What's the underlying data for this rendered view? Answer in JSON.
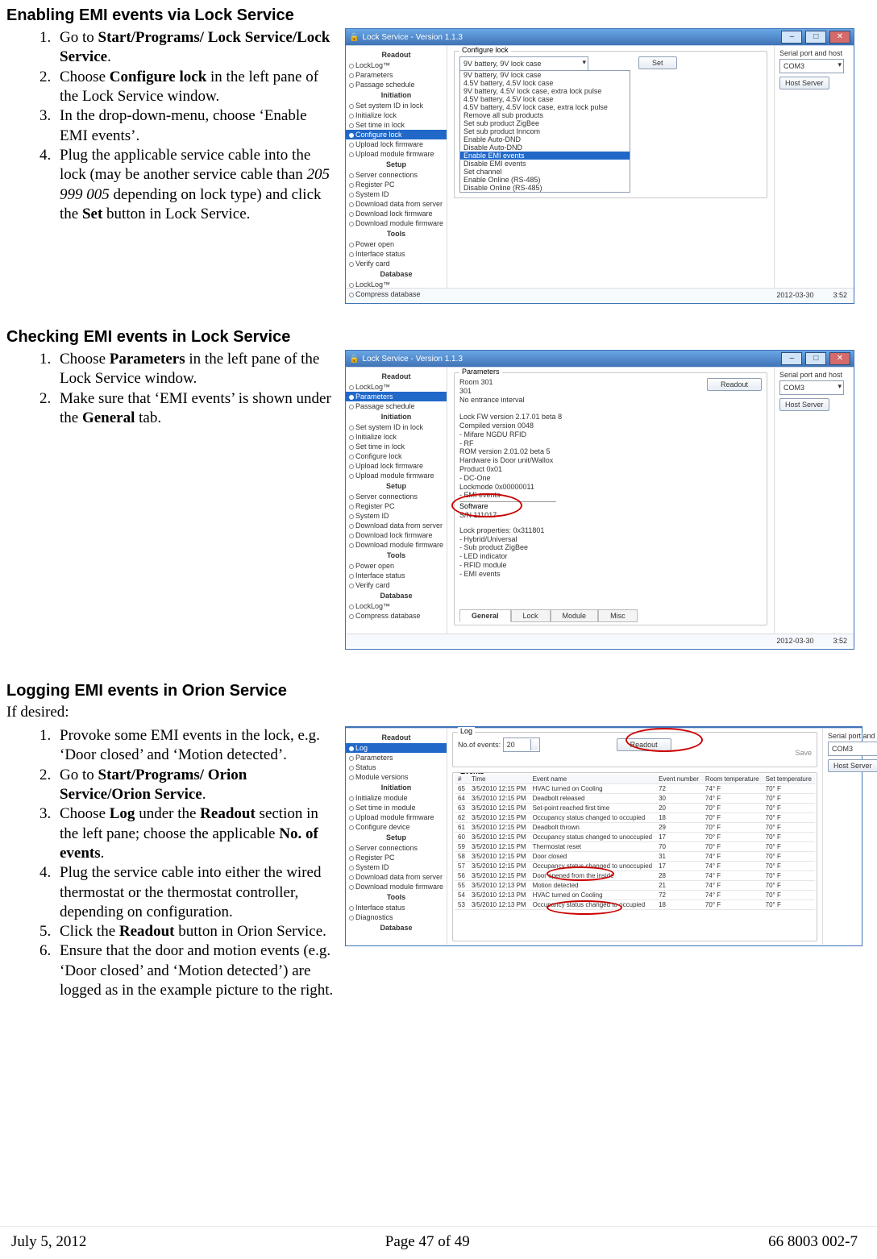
{
  "section1": {
    "title": "Enabling EMI events via Lock Service",
    "steps": [
      {
        "plain_pre": "Go to ",
        "b": "Start/Programs/ Lock Service/Lock Service",
        "plain_post": "."
      },
      {
        "plain_pre": "Choose ",
        "b": "Configure lock",
        "plain_post": " in the left pane of the Lock Service window."
      },
      {
        "plain": "In the drop-down-menu, choose ‘Enable EMI events’."
      },
      {
        "rich": "Plug the applicable service cable into the lock (may be another service cable than <span class=\"italic\">205 999 005</span> depending on lock type) and click the <span class=\"bold\">Set</span> button in Lock Service."
      }
    ]
  },
  "section2": {
    "title": "Checking EMI events in Lock Service",
    "steps": [
      {
        "rich": "Choose <span class=\"bold\">Parameters</span> in the left pane of the Lock Service window."
      },
      {
        "rich": "Make sure that ‘EMI events’ is shown under the <span class=\"bold\">General</span> tab."
      }
    ]
  },
  "section3": {
    "title": "Logging EMI events in Orion Service",
    "intro": "If desired:",
    "steps": [
      {
        "plain": "Provoke some EMI events in the lock, e.g. ‘Door closed’ and ‘Motion detected’."
      },
      {
        "rich": "Go to <span class=\"bold\">Start/Programs/ Orion Service/Orion Service</span>."
      },
      {
        "rich": "Choose <span class=\"bold\">Log</span> under the <span class=\"bold\">Readout</span> section in the left pane; choose the applicable <span class=\"bold\">No. of events</span>."
      },
      {
        "plain": "Plug the service cable into either the wired thermostat or the thermostat controller, depending on configuration."
      },
      {
        "rich": "Click the <span class=\"bold\">Readout</span> button in Orion Service."
      },
      {
        "plain": "Ensure that the door and motion events (e.g. ‘Door closed’ and ‘Motion detected’) are logged as in the example picture to the right."
      }
    ]
  },
  "win_lock": {
    "title": "Lock Service - Version 1.1.3",
    "status_date": "2012-03-30",
    "status_time": "3:52",
    "serial_label": "Serial port and host",
    "serial_value": "COM3",
    "host_btn": "Host Server",
    "left_pane": {
      "groups": [
        {
          "name": "Readout",
          "items": [
            "LockLog™",
            "Parameters",
            "Passage schedule"
          ]
        },
        {
          "name": "Initiation",
          "items": [
            "Set system ID in lock",
            "Initialize lock",
            "Set time in lock",
            "Configure lock",
            "Upload lock firmware",
            "Upload module firmware"
          ]
        },
        {
          "name": "Setup",
          "items": [
            "Server connections",
            "Register PC",
            "System ID",
            "Download data from server",
            "Download lock firmware",
            "Download module firmware"
          ]
        },
        {
          "name": "Tools",
          "items": [
            "Power open",
            "Interface status",
            "Verify card"
          ]
        },
        {
          "name": "Database",
          "items": [
            "LockLog™",
            "Compress database"
          ]
        }
      ],
      "selected_configure": "Configure lock",
      "selected_parameters": "Parameters"
    },
    "configure": {
      "legend": "Configure lock",
      "selected": "9V battery, 9V lock case",
      "set_btn": "Set",
      "options": [
        "9V battery, 9V lock case",
        "4.5V battery, 4.5V lock case",
        "9V battery, 4.5V lock case, extra lock pulse",
        "4.5V battery, 4.5V lock case",
        "4.5V battery, 4.5V lock case, extra lock pulse",
        "Remove all sub products",
        "Set sub product ZigBee",
        "Set sub product Inncom",
        "Enable Auto-DND",
        "Disable Auto-DND",
        "Enable EMI events",
        "Disable EMI events",
        "Set channel",
        "Enable Online (RS-485)",
        "Disable Online (RS-485)"
      ],
      "highlight_index": 10
    },
    "parameters": {
      "legend": "Parameters",
      "readout_btn": "Readout",
      "text": "Room 301\n301\nNo entrance interval\n\nLock FW version 2.17.01 beta 8\nCompiled version 0048\n- Mifare NGDU RFID\n- RF\nROM version 2.01.02 beta 5\nHardware is Door unit/Wallox\nProduct 0x01\n- DC-One\nLockmode 0x00000011\n- EMI events",
      "software_label": "Software",
      "sn": "S/N 111017",
      "props": "Lock properties: 0x311801\n- Hybrid/Universal\n- Sub product ZigBee\n- LED indicator\n- RFID module\n- EMI events",
      "tabs": [
        "General",
        "Lock",
        "Module",
        "Misc"
      ]
    }
  },
  "win_orion": {
    "status_date": "",
    "serial_label": "Serial port and host",
    "serial_value": "COM3",
    "host_btn": "Host Server",
    "left_pane": {
      "groups": [
        {
          "name": "Readout",
          "items": [
            "Log",
            "Parameters",
            "Status",
            "Module versions"
          ]
        },
        {
          "name": "Initiation",
          "items": [
            "Initialize module",
            "Set time in module",
            "Upload module firmware",
            "Configure device"
          ]
        },
        {
          "name": "Setup",
          "items": [
            "Server connections",
            "Register PC",
            "System ID",
            "Download data from server",
            "Download module firmware"
          ]
        },
        {
          "name": "Tools",
          "items": [
            "Interface status",
            "Diagnostics"
          ]
        },
        {
          "name": "Database",
          "items": []
        }
      ],
      "selected": "Log"
    },
    "log": {
      "legend": "Log",
      "no_label": "No.of events:",
      "no_value": "20",
      "readout_btn": "Readout",
      "save_btn": "Save",
      "events_legend": "Events",
      "headers": [
        "#",
        "Time",
        "Event name",
        "Event number",
        "Room temperature",
        "Set temperature"
      ],
      "rows": [
        [
          "65",
          "3/5/2010 12:15 PM",
          "HVAC turned on  Cooling",
          "72",
          "74° F",
          "70° F"
        ],
        [
          "64",
          "3/5/2010 12:15 PM",
          "Deadbolt released",
          "30",
          "74° F",
          "70° F"
        ],
        [
          "63",
          "3/5/2010 12:15 PM",
          "Set-point reached first time",
          "20",
          "70° F",
          "70° F"
        ],
        [
          "62",
          "3/5/2010 12:15 PM",
          "Occupancy status changed to occupied",
          "18",
          "70° F",
          "70° F"
        ],
        [
          "61",
          "3/5/2010 12:15 PM",
          "Deadbolt thrown",
          "29",
          "70° F",
          "70° F"
        ],
        [
          "60",
          "3/5/2010 12:15 PM",
          "Occupancy status changed to unoccupied",
          "17",
          "70° F",
          "70° F"
        ],
        [
          "59",
          "3/5/2010 12:15 PM",
          "Thermostat reset",
          "70",
          "70° F",
          "70° F"
        ],
        [
          "58",
          "3/5/2010 12:15 PM",
          "Door closed",
          "31",
          "74° F",
          "70° F"
        ],
        [
          "57",
          "3/5/2010 12:15 PM",
          "Occupancy status changed to unoccupied",
          "17",
          "74° F",
          "70° F"
        ],
        [
          "56",
          "3/5/2010 12:15 PM",
          "Door opened from the inside",
          "28",
          "74° F",
          "70° F"
        ],
        [
          "55",
          "3/5/2010 12:13 PM",
          "Motion detected",
          "21",
          "74° F",
          "70° F"
        ],
        [
          "54",
          "3/5/2010 12:13 PM",
          "HVAC turned on  Cooling",
          "72",
          "74° F",
          "70° F"
        ],
        [
          "53",
          "3/5/2010 12:13 PM",
          "Occupancy status changed to occupied",
          "18",
          "70° F",
          "70° F"
        ]
      ]
    }
  },
  "footer": {
    "date": "July 5, 2012",
    "page": "Page 47 of 49",
    "doc": "66 8003 002-7"
  }
}
